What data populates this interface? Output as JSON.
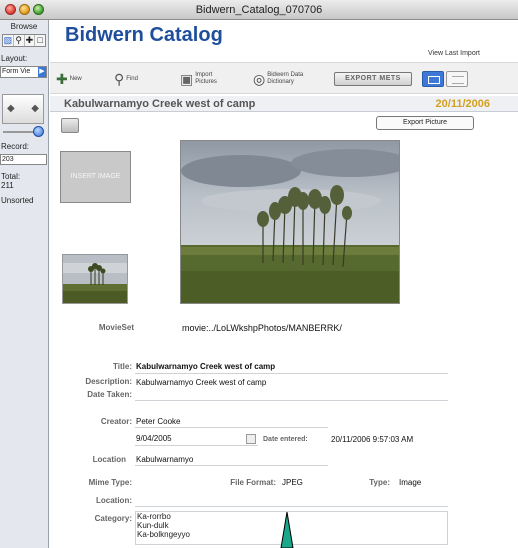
{
  "window": {
    "title": "Bidwern_Catalog_070706"
  },
  "sidebar": {
    "mode": "Browse",
    "tool_icons": [
      "browse-tool-icon",
      "find-tool-icon",
      "layout-tool-icon",
      "preview-tool-icon"
    ],
    "layout_label": "Layout:",
    "layout_value": "Form Vie",
    "record_label": "Record:",
    "record_value": "203",
    "total_label": "Total:",
    "total_value": "211",
    "sort_status": "Unsorted"
  },
  "header": {
    "app_title": "Bidwern Catalog",
    "view_last_import": "View Last Import"
  },
  "toolbar": {
    "new_label": "New",
    "find_label": "Find",
    "import_label_1": "Import",
    "import_label_2": "Pictures",
    "dictionary_label_1": "Bidwern Data",
    "dictionary_label_2": "Dictionary",
    "export_mets_label": "EXPORT METS"
  },
  "record": {
    "title_heading": "Kabulwarnamyo Creek west of camp",
    "date_heading": "20/11/2006",
    "export_picture_label": "Export Picture",
    "insert_image_label": "INSERT IMAGE",
    "movieset_label": "MovieSet",
    "movieset_value": "movie:../LoLWkshpPhotos/MANBERRK/",
    "title_label": "Title:",
    "title_value": "Kabulwarnamyo Creek west of camp",
    "description_label": "Description:",
    "description_value": "Kabulwarnamyo Creek west of camp",
    "date_taken_label": "Date Taken:",
    "creator_label": "Creator:",
    "creator_value": "Peter Cooke",
    "creator_date": "9/04/2005",
    "date_entered_label": "Date entered:",
    "date_entered_value": "20/11/2006 9:57:03 AM",
    "location_label": "Location",
    "location_value": "Kabulwarnamyo",
    "mime_label": "Mime Type:",
    "file_format_label": "File Format:",
    "file_format_value": "JPEG",
    "type_label": "Type:",
    "type_value": "Image",
    "location2_label": "Location:",
    "category_label": "Category:",
    "categories": [
      "Ka-rorrbo",
      "Kun-dulk",
      "Ka-bolkngeyyo"
    ]
  }
}
